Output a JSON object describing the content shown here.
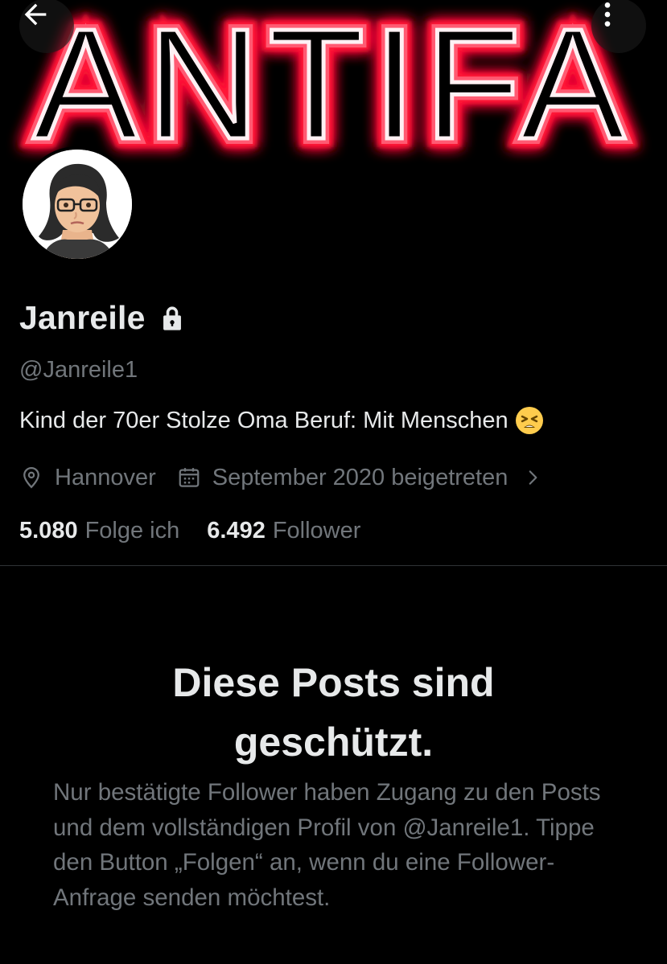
{
  "banner": {
    "text": "ANTIFA",
    "neon_color": "#ff1438",
    "back_icon": "arrow-left-icon",
    "more_icon": "more-vertical-icon"
  },
  "profile": {
    "display_name": "Janreile",
    "lock_icon": "lock-icon",
    "handle": "@Janreile1",
    "bio": "Kind der 70er Stolze Oma Beruf: Mit Menschen",
    "bio_emoji": "tired-face-emoji",
    "location": "Hannover",
    "location_icon": "location-pin-icon",
    "joined": "September 2020 beigetreten",
    "joined_icon": "calendar-icon",
    "following_count": "5.080",
    "following_label": "Folge ich",
    "followers_count": "6.492",
    "followers_label": "Follower"
  },
  "protected": {
    "title_line1": "Diese Posts sind",
    "title_line2": "geschützt.",
    "body": "Nur bestätigte Follower haben Zugang zu den Posts und dem vollständigen Profil von @Janreile1. Tippe den Button „Folgen“ an, wenn du eine Follower-Anfrage senden möchtest."
  },
  "colors": {
    "background": "#000000",
    "primary_text": "#e7e9ea",
    "secondary_text": "#71767b",
    "divider": "#2f3336"
  }
}
